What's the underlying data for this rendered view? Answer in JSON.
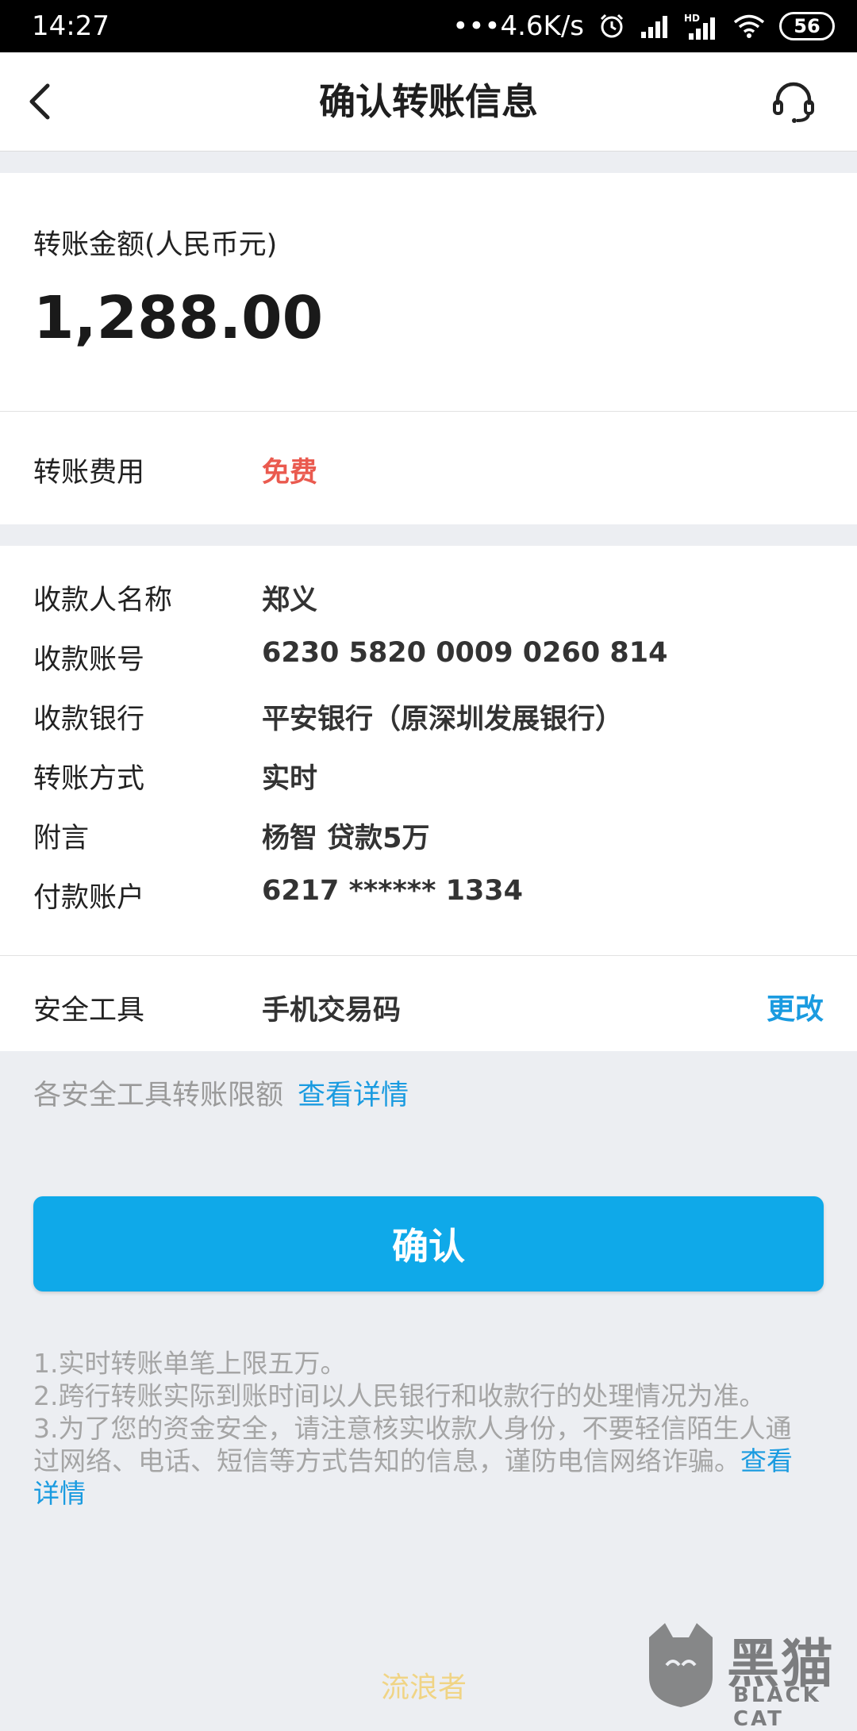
{
  "status_bar": {
    "time": "14:27",
    "network_speed": "•••4.6K/s",
    "battery": "56",
    "icons": [
      "alarm-icon",
      "signal-icon",
      "hd-signal-icon",
      "wifi-icon",
      "battery-icon"
    ]
  },
  "header": {
    "title": "确认转账信息",
    "back_icon": "chevron-left-icon",
    "service_icon": "headset-icon"
  },
  "amount": {
    "label": "转账金额(人民币元)",
    "value": "1,288.00"
  },
  "fee": {
    "label": "转账费用",
    "value": "免费",
    "value_color": "#ea5a4f"
  },
  "details": [
    {
      "label": "收款人名称",
      "value": "郑义"
    },
    {
      "label": "收款账号",
      "value": "6230 5820 0009 0260 814"
    },
    {
      "label": "收款银行",
      "value": "平安银行（原深圳发展银行）"
    },
    {
      "label": "转账方式",
      "value": "实时"
    },
    {
      "label": "附言",
      "value": "杨智 贷款5万"
    },
    {
      "label": "付款账户",
      "value": "6217 ****** 1334"
    }
  ],
  "security": {
    "label": "安全工具",
    "value": "手机交易码",
    "change_label": "更改"
  },
  "limit": {
    "text": "各安全工具转账限额",
    "link": "查看详情"
  },
  "confirm_button": {
    "label": "确认",
    "color": "#0fa9e9"
  },
  "notes": {
    "line1": "1.实时转账单笔上限五万。",
    "line2": "2.跨行转账实际到账时间以人民银行和收款行的处理情况为准。",
    "line3": "3.为了您的资金安全，请注意核实收款人身份，不要轻信陌生人通过网络、电话、短信等方式告知的信息，谨防电信网络诈骗。",
    "link": "查看详情"
  },
  "watermark": {
    "caption": "流浪者",
    "logo_big": "黑猫",
    "logo_small": "BLACK CAT",
    "logo_icon": "black-cat-logo-icon"
  },
  "colors": {
    "accent": "#1a9be0",
    "button": "#0fa9e9",
    "fee": "#ea5a4f",
    "background": "#eceef2"
  }
}
